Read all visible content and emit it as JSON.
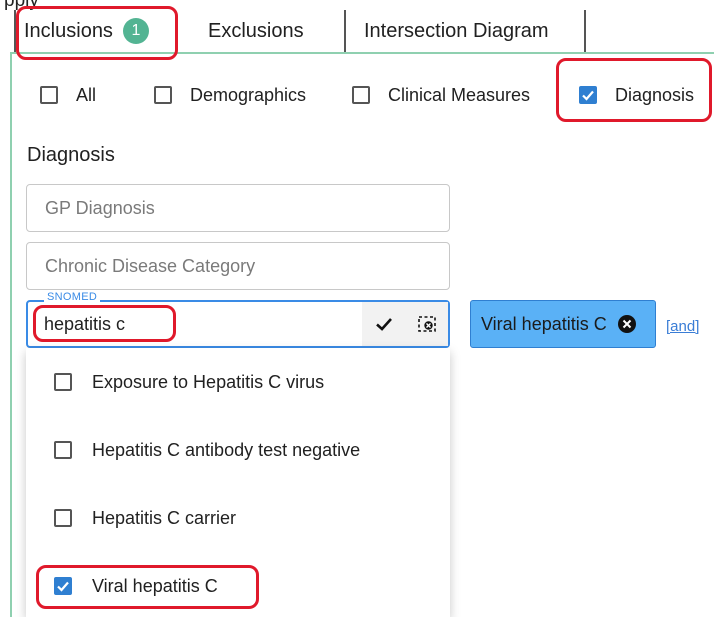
{
  "top_text": "pply",
  "tabs": {
    "inclusions": {
      "label": "Inclusions",
      "badge": "1"
    },
    "exclusions": {
      "label": "Exclusions"
    },
    "intersection": {
      "label": "Intersection Diagram"
    }
  },
  "filters": {
    "all": {
      "label": "All",
      "checked": false
    },
    "demographics": {
      "label": "Demographics",
      "checked": false
    },
    "clinical": {
      "label": "Clinical Measures",
      "checked": false
    },
    "diagnosis": {
      "label": "Diagnosis",
      "checked": true
    }
  },
  "diagnosis": {
    "title": "Diagnosis",
    "gp_placeholder": "GP Diagnosis",
    "chronic_placeholder": "Chronic Disease Category",
    "snomed": {
      "legend": "SNOMED",
      "value": "hepatitis c"
    },
    "selected_chip": "Viral hepatitis C",
    "and_link": "[and]",
    "options": [
      {
        "label": "Exposure to Hepatitis C virus",
        "checked": false
      },
      {
        "label": "Hepatitis C antibody test negative",
        "checked": false
      },
      {
        "label": "Hepatitis C carrier",
        "checked": false
      },
      {
        "label": "Viral hepatitis C",
        "checked": true
      }
    ]
  },
  "colors": {
    "accent_green": "#53b493",
    "accent_blue": "#2f7fd1",
    "chip_blue": "#5ab1f6",
    "highlight_red": "#e0192b"
  }
}
